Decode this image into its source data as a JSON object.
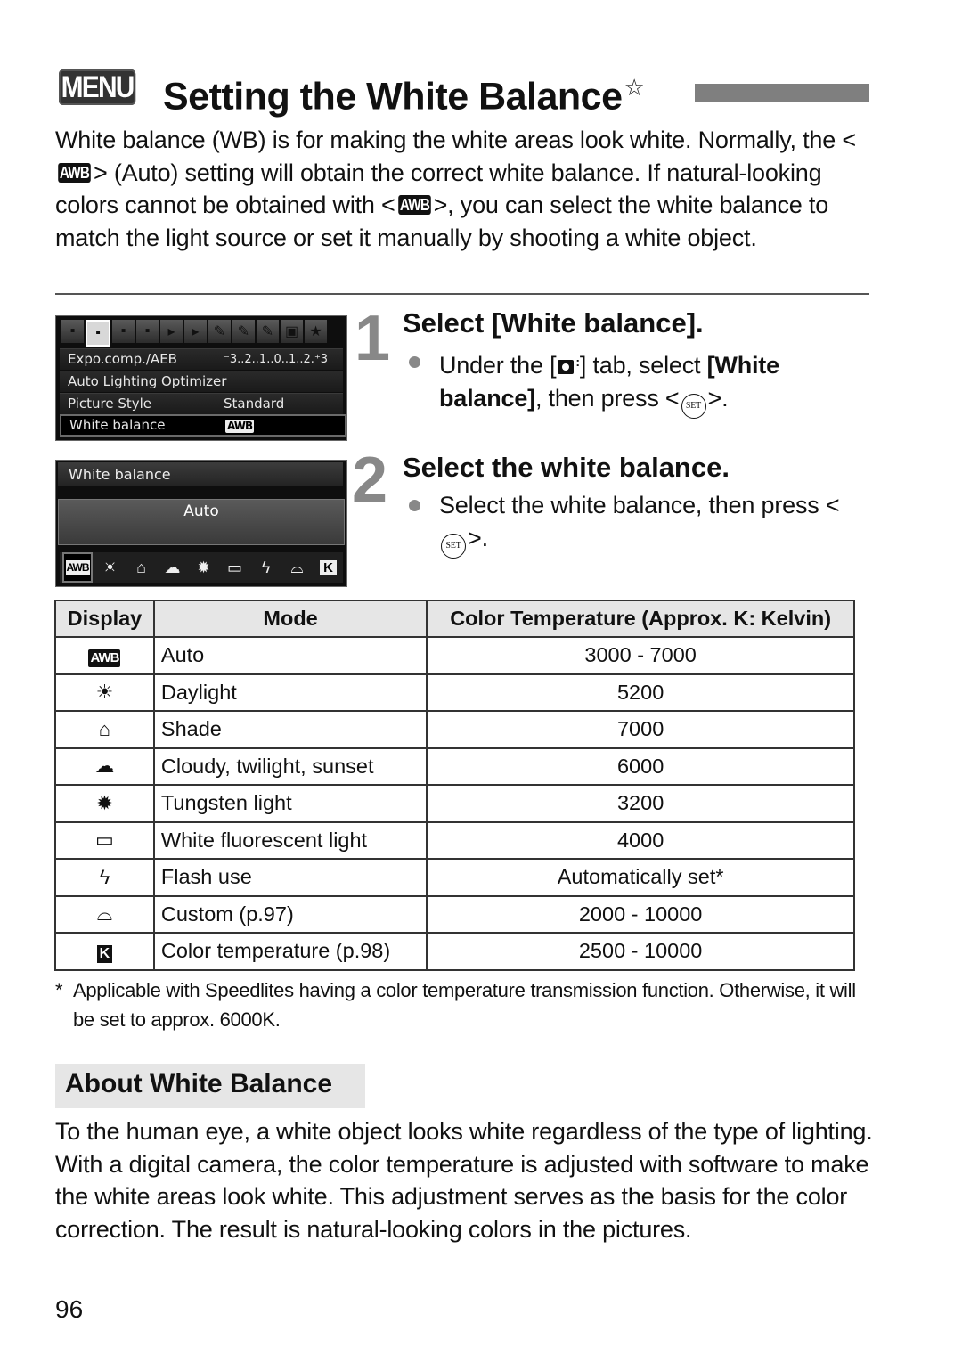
{
  "header": {
    "menu_badge": "MENU",
    "title": "Setting the White Balance",
    "title_mark": "☆"
  },
  "intro": {
    "p1": "White balance (WB) is for making the white areas look white. Normally, the <",
    "awb": "AWB",
    "p2": "> (Auto) setting will obtain the correct white balance. If natural-looking colors cannot be obtained with <",
    "p3": ">, you can select the white balance to match the light source or set it manually by shooting a white object."
  },
  "lcd_menu": {
    "tabs": [
      "▪",
      "▪",
      "▪",
      "▪",
      "▸",
      "▸",
      "✎",
      "✎",
      "✎",
      "▣",
      "★"
    ],
    "active_tab": 1,
    "rows": [
      {
        "label": "Expo.comp./AEB",
        "value": "⁻3..2..1..0..1..2.⁺3"
      },
      {
        "label": "Auto Lighting Optimizer",
        "value": ""
      },
      {
        "label": "Picture Style",
        "value": "Standard"
      },
      {
        "label": "White balance",
        "value": "AWB"
      }
    ]
  },
  "lcd_wb": {
    "header": "White balance",
    "selected_label": "Auto",
    "icons": [
      "AWB",
      "☀",
      "⌂",
      "☁",
      "✹",
      "▭",
      "ϟ",
      "⌓",
      "K"
    ]
  },
  "steps": [
    {
      "number": "1",
      "heading": "Select [White balance].",
      "text_pre": "Under the [",
      "text_mid": "] tab, select ",
      "text_bold": "[White balance]",
      "text_post": ", then press <",
      "set_label": "SET",
      "text_end": ">."
    },
    {
      "number": "2",
      "heading": "Select the white balance.",
      "text_pre": "Select the white balance, then press <",
      "set_label": "SET",
      "text_end": ">."
    }
  ],
  "table": {
    "headers": [
      "Display",
      "Mode",
      "Color Temperature (Approx. K: Kelvin)"
    ],
    "rows": [
      {
        "icon": "AWB",
        "mode": "Auto",
        "temp": "3000 - 7000"
      },
      {
        "icon": "☀",
        "mode": "Daylight",
        "temp": "5200"
      },
      {
        "icon": "⌂",
        "mode": "Shade",
        "temp": "7000"
      },
      {
        "icon": "☁",
        "mode": "Cloudy, twilight, sunset",
        "temp": "6000"
      },
      {
        "icon": "✹",
        "mode": "Tungsten light",
        "temp": "3200"
      },
      {
        "icon": "▭",
        "mode": "White fluorescent light",
        "temp": "4000"
      },
      {
        "icon": "ϟ",
        "mode": "Flash use",
        "temp": "Automatically set*"
      },
      {
        "icon": "⌓",
        "mode": "Custom (p.97)",
        "temp": "2000 - 10000"
      },
      {
        "icon": "K",
        "mode": "Color temperature (p.98)",
        "temp": "2500 - 10000"
      }
    ]
  },
  "footnote": {
    "marker": "*",
    "text": "Applicable with Speedlites having a color temperature transmission function. Otherwise, it will be set to approx. 6000K."
  },
  "about": {
    "title": "About White Balance",
    "text": "To the human eye, a white object looks white regardless of the type of lighting. With a digital camera, the color temperature is adjusted with software to make the white areas look white. This adjustment serves as the basis for the color correction. The result is natural-looking colors in the pictures."
  },
  "page_number": "96"
}
